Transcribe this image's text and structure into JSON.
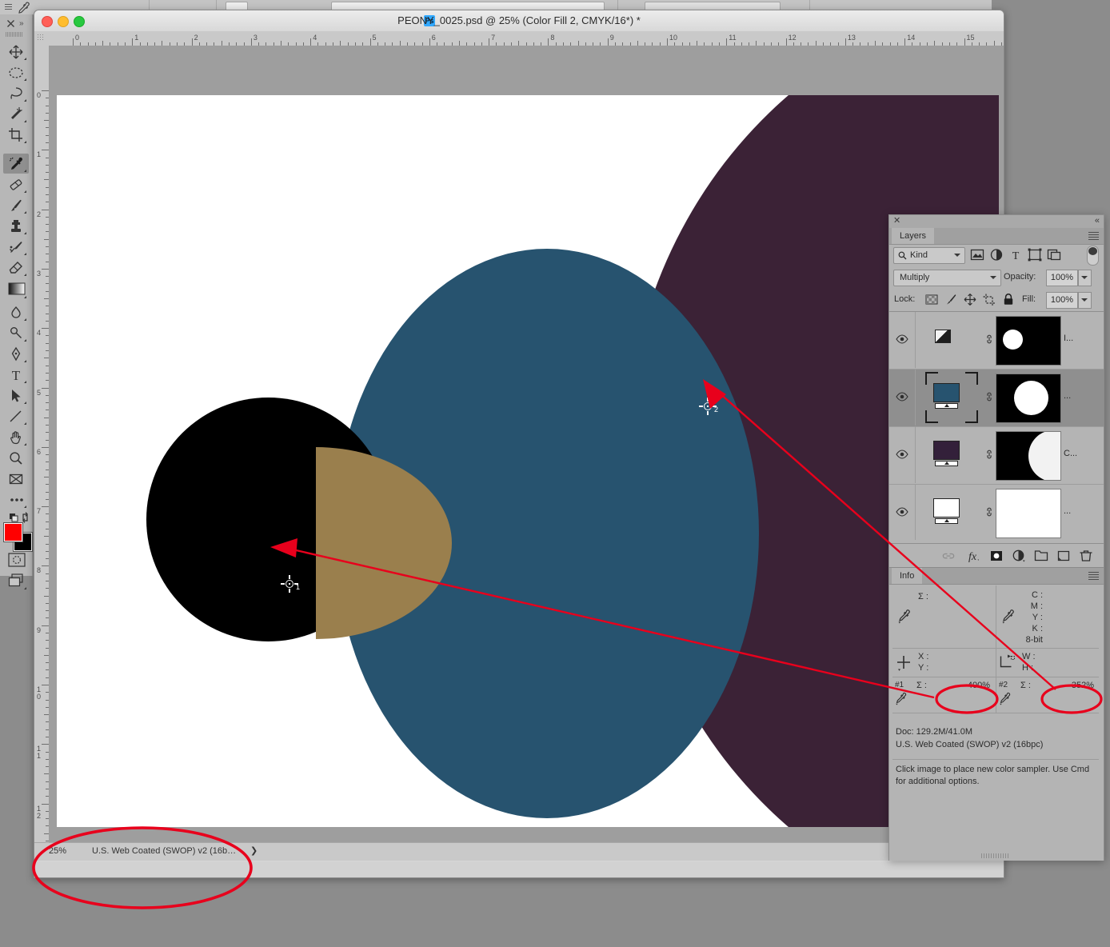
{
  "window": {
    "title": "PEONY_0025.psd @ 25% (Color Fill 2, CMYK/16*) *",
    "app_badge": "Ps"
  },
  "rulers": {
    "unit": "inches",
    "horizontal_labels": [
      "0",
      "1",
      "2",
      "3",
      "4",
      "5",
      "6",
      "7",
      "8",
      "9",
      "10",
      "11",
      "12",
      "13",
      "14",
      "15"
    ],
    "vertical_labels": [
      "0",
      "1",
      "2",
      "3",
      "4",
      "5",
      "6",
      "7",
      "8",
      "9",
      "10",
      "11",
      "12"
    ]
  },
  "toolbar": {
    "tools": [
      {
        "name": "move-tool",
        "glyph": "move",
        "selected": false
      },
      {
        "name": "elliptical-marquee-tool",
        "glyph": "marquee",
        "selected": false
      },
      {
        "name": "lasso-tool",
        "glyph": "lasso",
        "selected": false
      },
      {
        "name": "magic-wand-tool",
        "glyph": "wand",
        "selected": false
      },
      {
        "name": "crop-tool",
        "glyph": "crop",
        "selected": false
      },
      {
        "name": "eyedropper-tool",
        "glyph": "eyedropper",
        "selected": true
      },
      {
        "name": "healing-brush-tool",
        "glyph": "heal",
        "selected": false
      },
      {
        "name": "brush-tool",
        "glyph": "brush",
        "selected": false
      },
      {
        "name": "clone-stamp-tool",
        "glyph": "stamp",
        "selected": false
      },
      {
        "name": "history-brush-tool",
        "glyph": "historybrush",
        "selected": false
      },
      {
        "name": "eraser-tool",
        "glyph": "eraser",
        "selected": false
      },
      {
        "name": "gradient-tool",
        "glyph": "gradient",
        "selected": false
      },
      {
        "name": "blur-tool",
        "glyph": "blur",
        "selected": false
      },
      {
        "name": "dodge-tool",
        "glyph": "dodge",
        "selected": false
      },
      {
        "name": "pen-tool",
        "glyph": "pen",
        "selected": false
      },
      {
        "name": "type-tool",
        "glyph": "type",
        "selected": false
      },
      {
        "name": "path-selection-tool",
        "glyph": "arrow",
        "selected": false
      },
      {
        "name": "line-tool",
        "glyph": "line",
        "selected": false
      },
      {
        "name": "hand-tool",
        "glyph": "hand",
        "selected": false
      },
      {
        "name": "zoom-tool",
        "glyph": "zoom",
        "selected": false
      },
      {
        "name": "frame-tool",
        "glyph": "frame",
        "selected": false
      },
      {
        "name": "edit-toolbar-tool",
        "glyph": "ellipsis",
        "selected": false
      }
    ],
    "foreground_color": "#ff0000",
    "background_color": "#000000"
  },
  "layers_panel": {
    "tab_label": "Layers",
    "filter": {
      "kind_label": "Kind",
      "selected_kind": "Kind"
    },
    "blend_mode": "Multiply",
    "opacity_label": "Opacity:",
    "opacity_value": "100%",
    "lock_label": "Lock:",
    "fill_label": "Fill:",
    "fill_value": "100%",
    "rows": [
      {
        "name": "layer-row-1",
        "short_name": "I...",
        "visible": true,
        "selected": false,
        "kind": "adjustment",
        "thumb_color": "#e8e8e8",
        "mask": "small-circle",
        "linked": true
      },
      {
        "name": "layer-row-2",
        "short_name": "...",
        "visible": true,
        "selected": true,
        "kind": "fill",
        "thumb_color": "#27536f",
        "mask": "big-circle",
        "linked": true
      },
      {
        "name": "layer-row-3",
        "short_name": "C...",
        "visible": true,
        "selected": false,
        "kind": "fill",
        "thumb_color": "#33203a",
        "mask": "right-lobe",
        "linked": true
      },
      {
        "name": "layer-row-4",
        "short_name": "...",
        "visible": true,
        "selected": false,
        "kind": "fill",
        "thumb_color": "#ffffff",
        "mask": "full-white",
        "linked": true
      }
    ],
    "bottom_buttons": [
      "link-layers",
      "add-layer-style",
      "add-layer-mask",
      "new-fill-adjustment-layer",
      "new-group",
      "new-layer",
      "delete-layer"
    ]
  },
  "info_panel": {
    "tab_label": "Info",
    "readout1": {
      "icon": "eyedropper-icon",
      "labels": [
        "Σ :"
      ]
    },
    "readout2": {
      "icon": "eyedropper-icon",
      "labels": [
        "C :",
        "M :",
        "Y :",
        "K :"
      ],
      "depth": "8-bit"
    },
    "position": {
      "icon": "crosshair-icon",
      "labels": [
        "X :",
        "Y :"
      ]
    },
    "dimensions": {
      "icon": "marquee-icon",
      "labels": [
        "W :",
        "H :"
      ]
    },
    "samplers": [
      {
        "id": "#1",
        "label": "Σ :",
        "value": "400%",
        "highlighted": true
      },
      {
        "id": "#2",
        "label": "Σ :",
        "value": "352%",
        "highlighted": true
      }
    ],
    "doc_line1": "Doc: 129.2M/41.0M",
    "doc_line2": "U.S. Web Coated (SWOP) v2 (16bpc)",
    "hint": "Click image to place new color sampler.  Use Cmd for additional options."
  },
  "status_bar": {
    "zoom": "25%",
    "profile": "U.S. Web Coated (SWOP) v2 (16b…",
    "arrow": "❯",
    "highlighted": true
  },
  "canvas": {
    "shapes": [
      {
        "name": "maroon-ellipse",
        "color": "#3b2236"
      },
      {
        "name": "blue-ellipse",
        "color": "#27536f"
      },
      {
        "name": "black-circle",
        "color": "#000000"
      },
      {
        "name": "tan-overlap",
        "color": "#9a7f4d"
      },
      {
        "name": "background",
        "color": "#ffffff"
      }
    ],
    "color_samplers": [
      {
        "name": "color-sampler-1",
        "number": "1"
      },
      {
        "name": "color-sampler-2",
        "number": "2"
      }
    ]
  },
  "annotations": {
    "accent_color": "#e8001c",
    "items": [
      {
        "name": "arrow-to-sampler-1",
        "type": "arrow"
      },
      {
        "name": "arrow-to-sampler-2",
        "type": "arrow"
      },
      {
        "name": "ellipse-sampler1-value",
        "type": "ellipse"
      },
      {
        "name": "ellipse-sampler2-value",
        "type": "ellipse"
      },
      {
        "name": "ellipse-status-bar",
        "type": "ellipse"
      }
    ]
  }
}
